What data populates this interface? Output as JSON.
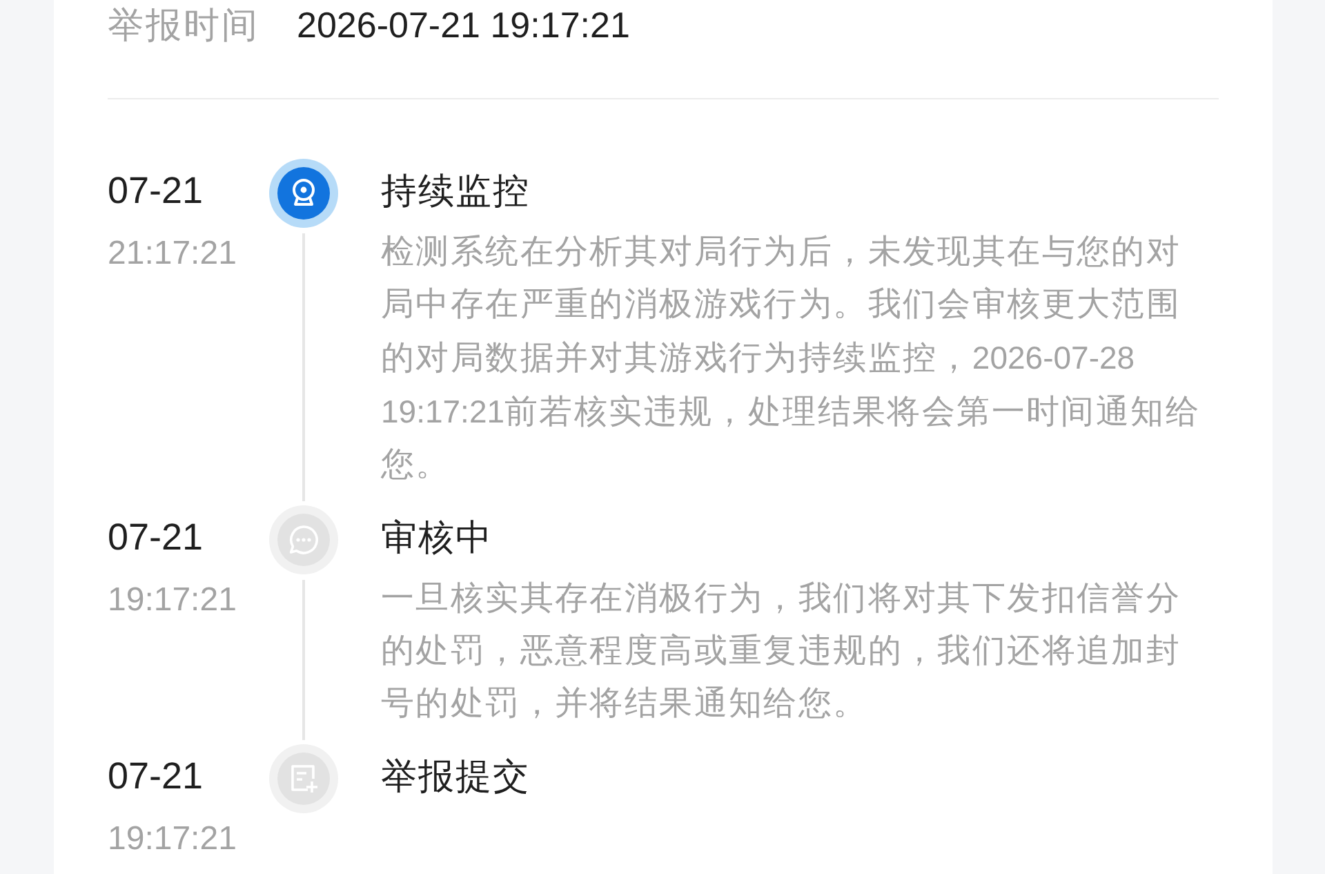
{
  "report_time": {
    "label": "举报时间",
    "value": "2026-07-21 19:17:21"
  },
  "timeline": [
    {
      "kind": "monitoring",
      "active": true,
      "date": "07-21",
      "time": "21:17:21",
      "title": "持续监控",
      "description": "检测系统在分析其对局行为后，未发现其在与您的对局中存在严重的消极游戏行为。我们会审核更大范围的对局数据并对其游戏行为持续监控，2026-07-28 19:17:21前若核实违规，处理结果将会第一时间通知给您。"
    },
    {
      "kind": "reviewing",
      "active": false,
      "date": "07-21",
      "time": "19:17:21",
      "title": "审核中",
      "description": "一旦核实其存在消极行为，我们将对其下发扣信誉分的处罚，恶意程度高或重复违规的，我们还将追加封号的处罚，并将结果通知给您。"
    },
    {
      "kind": "submitted",
      "active": false,
      "date": "07-21",
      "time": "19:17:21",
      "title": "举报提交"
    }
  ]
}
